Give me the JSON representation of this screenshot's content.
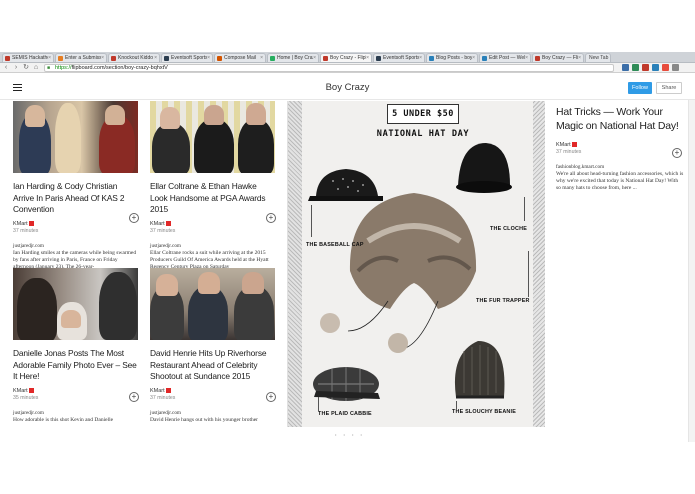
{
  "browser": {
    "tabs": [
      {
        "label": "SEMIS Hackathon",
        "color": "#c0392b"
      },
      {
        "label": "Enter a Submission",
        "color": "#e67e22"
      },
      {
        "label": "Knockout Kiddo",
        "color": "#c0392b"
      },
      {
        "label": "Eventsoft Sports",
        "color": "#2c3e50"
      },
      {
        "label": "Compose Mail",
        "color": "#d35400"
      },
      {
        "label": "Home | Boy Crazy",
        "color": "#27ae60"
      },
      {
        "label": "Boy Crazy - Flipboard",
        "color": "#c0392b"
      },
      {
        "label": "Eventsoft Sports",
        "color": "#2c3e50"
      },
      {
        "label": "Blog Posts - boy crazy",
        "color": "#2980b9"
      },
      {
        "label": "Edit Post — Web",
        "color": "#2980b9"
      },
      {
        "label": "Boy Crazy — Flip",
        "color": "#c0392b"
      }
    ],
    "new_tab_label": "New Tab",
    "url_https": "https://",
    "url_rest": "flipboard.com/section/boy-crazy-bqhxtV"
  },
  "header": {
    "title": "Boy Crazy",
    "follow_label": "Follow",
    "share_label": "Share"
  },
  "articles": [
    {
      "title": "Ian Harding & Cody Christian Arrive In Paris Ahead Of KAS 2 Convention",
      "source": "KMart",
      "time": "37 minutes",
      "domain": "justjaredjr.com",
      "snippet": "Ian Harding smiles at the cameras while being swarmed by fans after arriving in Paris, France on Friday afternoon (January 23). The 26-year-"
    },
    {
      "title": "Ellar Coltrane & Ethan Hawke Look Handsome at PGA Awards 2015",
      "source": "KMart",
      "time": "37 minutes",
      "domain": "justjaredjr.com",
      "snippet": "Ellar Coltrane rocks a suit while arriving at the 2015 Producers Guild Of America Awards held at the Hyatt Regency Century Plaza on Saturday"
    },
    {
      "title": "Danielle Jonas Posts The Most Adorable Family Photo Ever – See It Here!",
      "source": "KMart",
      "time": "35 minutes",
      "domain": "justjaredjr.com",
      "snippet": "How adorable is this shot Kevin and Danielle"
    },
    {
      "title": "David Henrie Hits Up Riverhorse Restaurant Ahead of Celebrity Shootout at Sundance 2015",
      "source": "KMart",
      "time": "37 minutes",
      "domain": "justjaredjr.com",
      "snippet": "David Henrie hangs out with his younger brother"
    }
  ],
  "feature": {
    "banner": "5 UNDER $50",
    "heading": "NATIONAL HAT DAY",
    "labels": {
      "baseball": "THE BASEBALL CAP",
      "cloche": "THE CLOCHE",
      "trapper": "THE FUR TRAPPER",
      "cabbie": "THE PLAID CABBIE",
      "beanie": "THE SLOUCHY BEANIE"
    }
  },
  "right_article": {
    "title": "Hat Tricks — Work Your Magic on National Hat Day!",
    "source": "KMart",
    "time": "37 minutes",
    "domain": "fashionblog.kmart.com",
    "snippet": "We're all about head-turning fashion accessories, which is why we're excited that today is National Hat Day! With so many hats to choose from, here ..."
  },
  "pager": "• • • •"
}
